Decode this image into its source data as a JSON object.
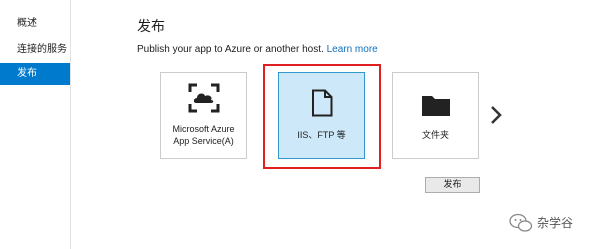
{
  "sidebar": {
    "items": [
      {
        "label": "概述"
      },
      {
        "label": "连接的服务"
      },
      {
        "label": "发布",
        "active": true
      }
    ]
  },
  "main": {
    "title": "发布",
    "subtitle": "Publish your app to Azure or another host.",
    "learn_more": "Learn more"
  },
  "targets": [
    {
      "label_line1": "Microsoft Azure",
      "label_line2": "App Service(A)",
      "icon": "azure-app-service-icon"
    },
    {
      "label": "IIS、FTP 等",
      "icon": "document-icon",
      "selected": true
    },
    {
      "label": "文件夹",
      "icon": "folder-icon"
    }
  ],
  "publish_button": "发布",
  "watermark": {
    "text": "杂学谷"
  },
  "colors": {
    "accent": "#007acc",
    "selected_bg": "#cde8f8",
    "highlight": "#e02020",
    "link": "#0e70c0"
  }
}
